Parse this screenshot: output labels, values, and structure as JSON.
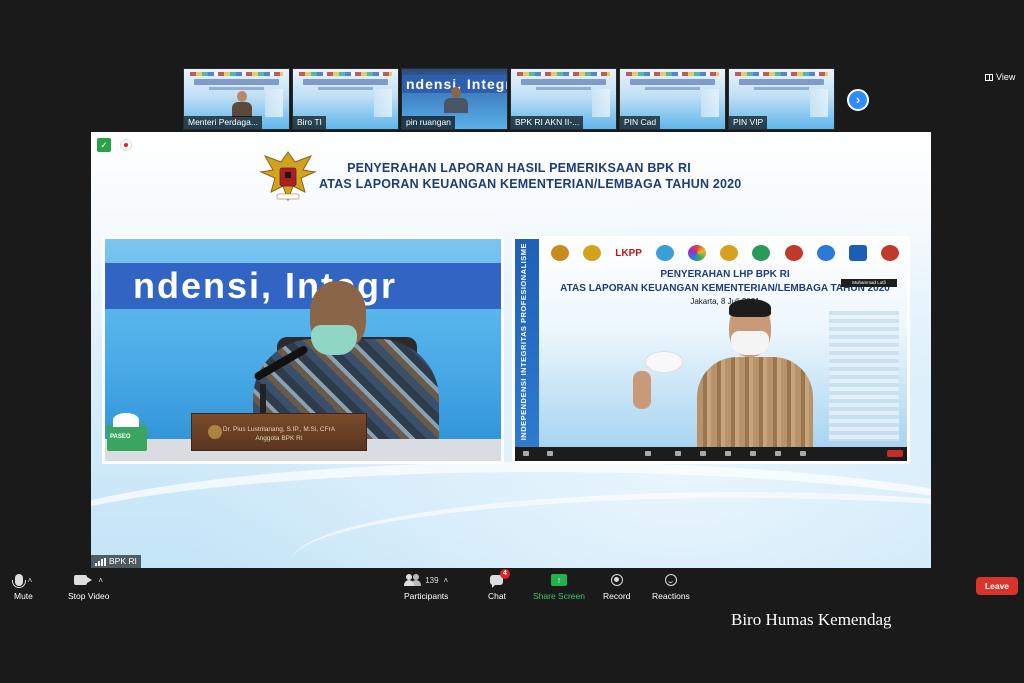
{
  "thumbnails": [
    {
      "name": "Menteri Perdaga..."
    },
    {
      "name": "Biro TI"
    },
    {
      "name": "pin ruangan",
      "band_text": "ndensi, Integr"
    },
    {
      "name": "BPK RI AKN II-..."
    },
    {
      "name": "PIN Cad"
    },
    {
      "name": "PIN VIP"
    }
  ],
  "view_label": "View",
  "share": {
    "title_line1": "PENYERAHAN LAPORAN HASIL PEMERIKSAAN BPK RI",
    "title_line2": "ATAS LAPORAN KEUANGAN KEMENTERIAN/LEMBAGA TAHUN 2020",
    "left_video": {
      "band_text": "ndensi, Integr",
      "plate_name": "Dr. Pius Lustrilanang, S.IP., M.Si, CFrA",
      "plate_role": "Anggota BPK RI",
      "tissue_label": "PASEO"
    },
    "right_video": {
      "sidebar_text": "INDEPENDENSI  INTEGRITAS  PROFESIONALISME",
      "logo_lkpp": "LKPP",
      "heading_line1": "PENYERAHAN LHP BPK RI",
      "heading_line2": "ATAS LAPORAN KEUANGAN KEMENTERIAN/LEMBAGA TAHUN 2020",
      "date_line": "Jakarta, 8 Juli 2021",
      "name_tag": "Muhammad Lutfi"
    },
    "presenter_name": "BPK RI"
  },
  "toolbar": {
    "mute": "Mute",
    "stop_video": "Stop Video",
    "participants": "Participants",
    "participants_count": "139",
    "chat": "Chat",
    "chat_badge": "4",
    "share_screen": "Share Screen",
    "record": "Record",
    "reactions": "Reactions",
    "leave": "Leave"
  },
  "watermark": "Biro Humas Kemendag",
  "colors": {
    "accent": "#2d8cff",
    "share_green": "#3ec46a",
    "leave_red": "#d9342b",
    "title_navy": "#1d3d78"
  }
}
